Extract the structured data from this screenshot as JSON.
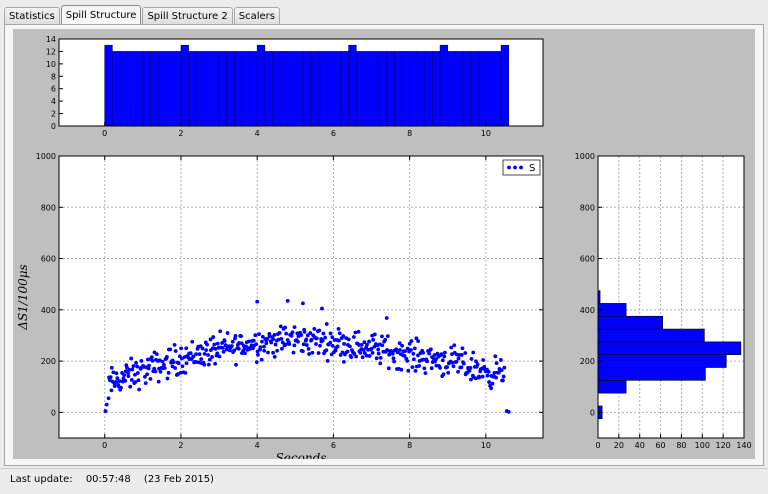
{
  "tabs": [
    {
      "label": "Statistics",
      "active": false
    },
    {
      "label": "Spill Structure",
      "active": true
    },
    {
      "label": "Spill Structure 2",
      "active": false
    },
    {
      "label": "Scalers",
      "active": false
    }
  ],
  "status": {
    "label": "Last update:",
    "time": "00:57:48",
    "date": "(23 Feb 2015)"
  },
  "colors": {
    "bar": "#0000ff",
    "edge": "#000080",
    "figure_bg": "#bfbfbf",
    "grid": "#b0b0b0"
  },
  "chart_data": [
    {
      "type": "bar",
      "title": "",
      "xlim": [
        -1.2,
        11.5
      ],
      "ylim": [
        0,
        14
      ],
      "xticks": [
        0,
        2,
        4,
        6,
        8,
        10
      ],
      "yticks": [
        0,
        2,
        4,
        6,
        8,
        10,
        12,
        14
      ],
      "bin_start": 0.0,
      "bin_width": 0.2,
      "values": [
        13,
        12,
        12,
        12,
        12,
        12,
        12,
        12,
        12,
        12,
        13,
        12,
        12,
        12,
        12,
        12,
        12,
        12,
        12,
        12,
        13,
        12,
        12,
        12,
        12,
        12,
        12,
        12,
        12,
        12,
        12,
        12,
        13,
        12,
        12,
        12,
        12,
        12,
        12,
        12,
        12,
        12,
        12,
        12,
        13,
        12,
        12,
        12,
        12,
        12,
        12,
        12,
        13
      ]
    },
    {
      "type": "scatter",
      "xlabel": "Seconds",
      "ylabel": "ΔS1/100μs",
      "legend": [
        "S"
      ],
      "legend_position": "top-right",
      "xlim": [
        -1.2,
        11.5
      ],
      "ylim": [
        -100,
        1000
      ],
      "xticks": [
        0,
        2,
        4,
        6,
        8,
        10
      ],
      "yticks": [
        0,
        200,
        400,
        600,
        800,
        1000
      ],
      "grid": true,
      "envelope": [
        [
          0.0,
          0
        ],
        [
          0.1,
          110
        ],
        [
          0.5,
          135
        ],
        [
          1.0,
          160
        ],
        [
          2.0,
          210
        ],
        [
          3.0,
          245
        ],
        [
          4.0,
          270
        ],
        [
          5.0,
          285
        ],
        [
          6.0,
          275
        ],
        [
          7.0,
          250
        ],
        [
          8.0,
          225
        ],
        [
          9.0,
          200
        ],
        [
          10.0,
          160
        ],
        [
          10.5,
          150
        ]
      ],
      "spread": 55,
      "n_points": 520,
      "outliers": [
        [
          0.02,
          5
        ],
        [
          0.05,
          30
        ],
        [
          0.1,
          55
        ],
        [
          10.55,
          5
        ],
        [
          10.6,
          2
        ],
        [
          4.8,
          435
        ],
        [
          4.0,
          432
        ],
        [
          5.2,
          425
        ],
        [
          5.7,
          405
        ],
        [
          7.4,
          368
        ]
      ]
    },
    {
      "type": "barh",
      "xlim": [
        0,
        140
      ],
      "ylim": [
        -100,
        1000
      ],
      "xticks": [
        0,
        20,
        40,
        60,
        80,
        100,
        120,
        140
      ],
      "yticks": [
        0,
        200,
        400,
        600,
        800,
        1000
      ],
      "bin_start": -25,
      "bin_width": 50,
      "values": [
        4,
        0,
        27,
        103,
        123,
        137,
        102,
        62,
        27,
        2,
        0
      ]
    }
  ]
}
